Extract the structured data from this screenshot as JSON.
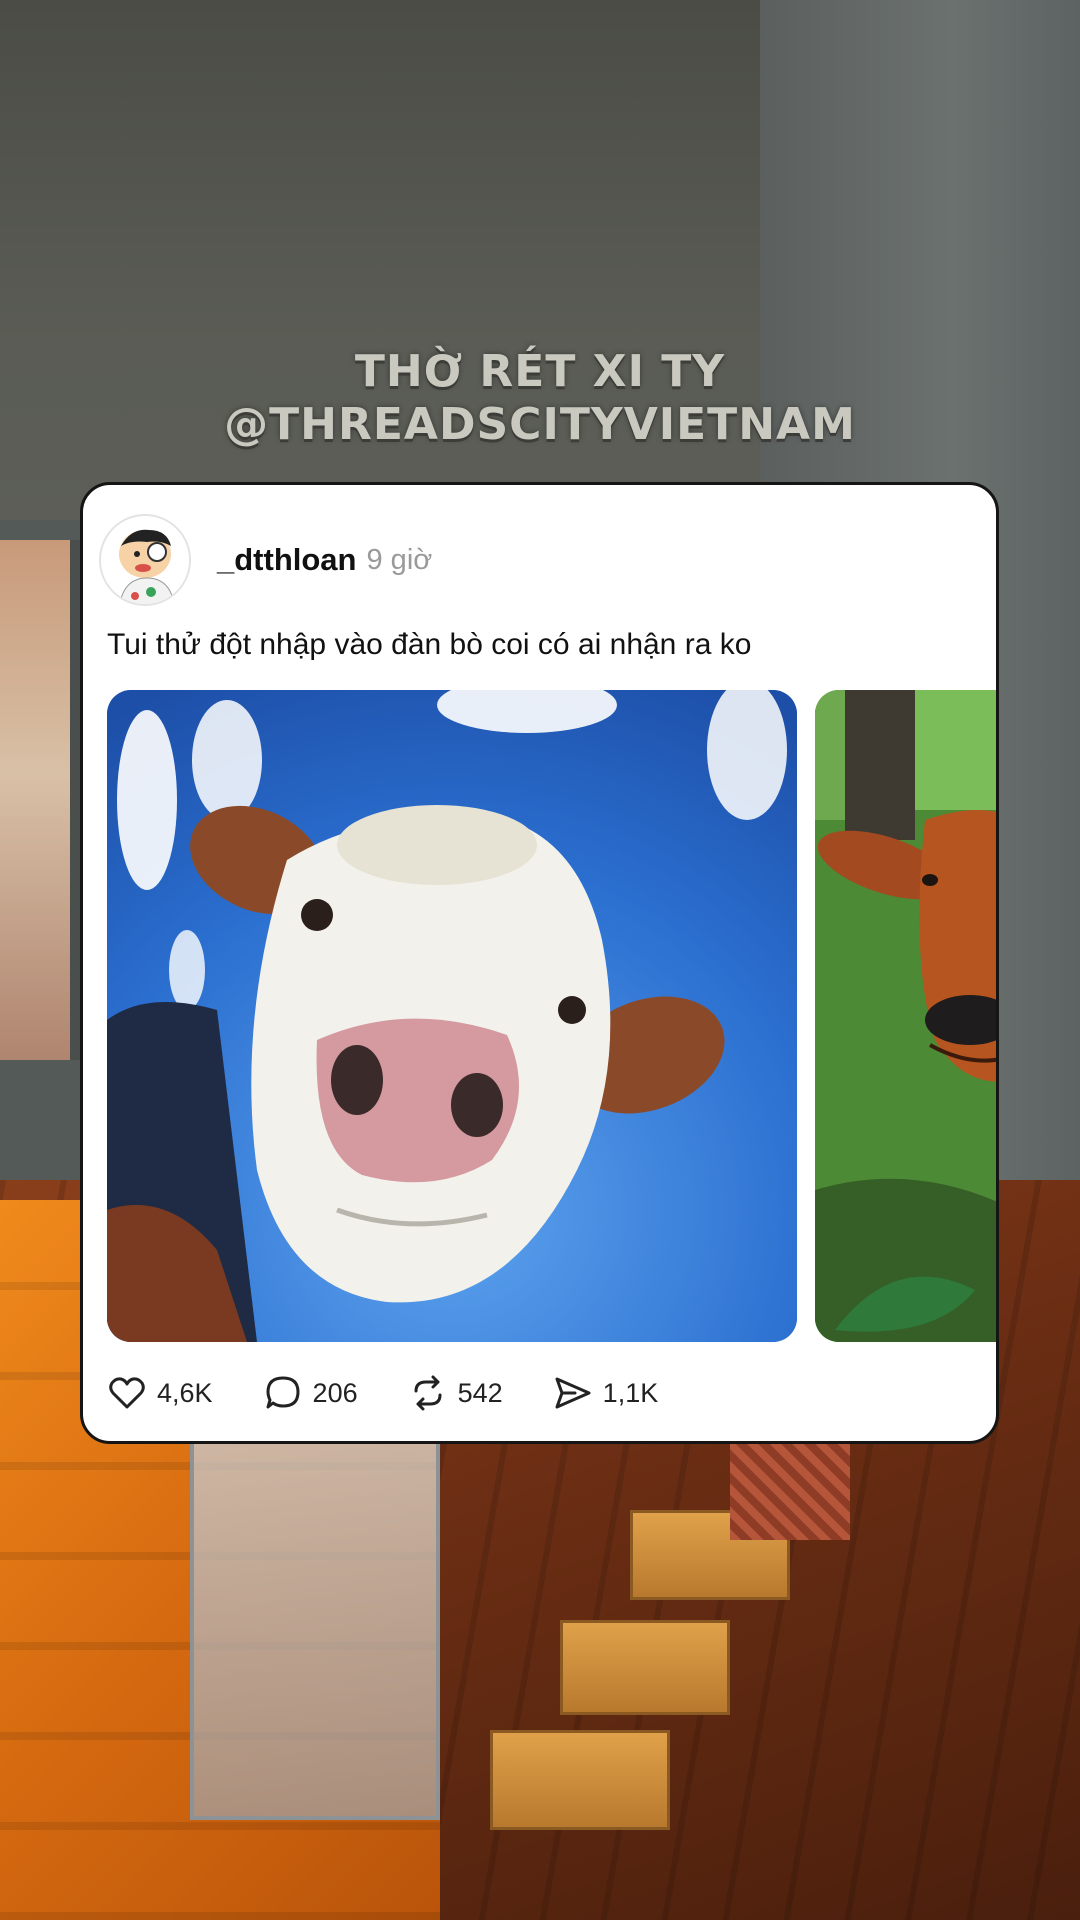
{
  "watermark": {
    "line1": "THỜ RÉT XI TY",
    "line2": "@THREADSCITYVIETNAM"
  },
  "post": {
    "username": "_dtthloan",
    "time": "9 giờ",
    "text": "Tui thử đột nhập vào đàn bò coi có ai nhận ra ko",
    "images": [
      {
        "subject": "close-up of white cow face against blue sky (fisheye)"
      },
      {
        "subject": "brown cow peeking behind tree in grass"
      }
    ],
    "stats": {
      "likes": "4,6K",
      "comments": "206",
      "reposts": "542",
      "shares": "1,1K"
    }
  },
  "colors": {
    "card_bg": "#ffffff",
    "username": "#111111",
    "time": "#9a9a9a",
    "sky": "#2f76d8",
    "grass": "#3f7d2e"
  },
  "icons": {
    "like": "heart-icon",
    "comment": "comment-bubble-icon",
    "repost": "repost-icon",
    "share": "send-icon"
  }
}
